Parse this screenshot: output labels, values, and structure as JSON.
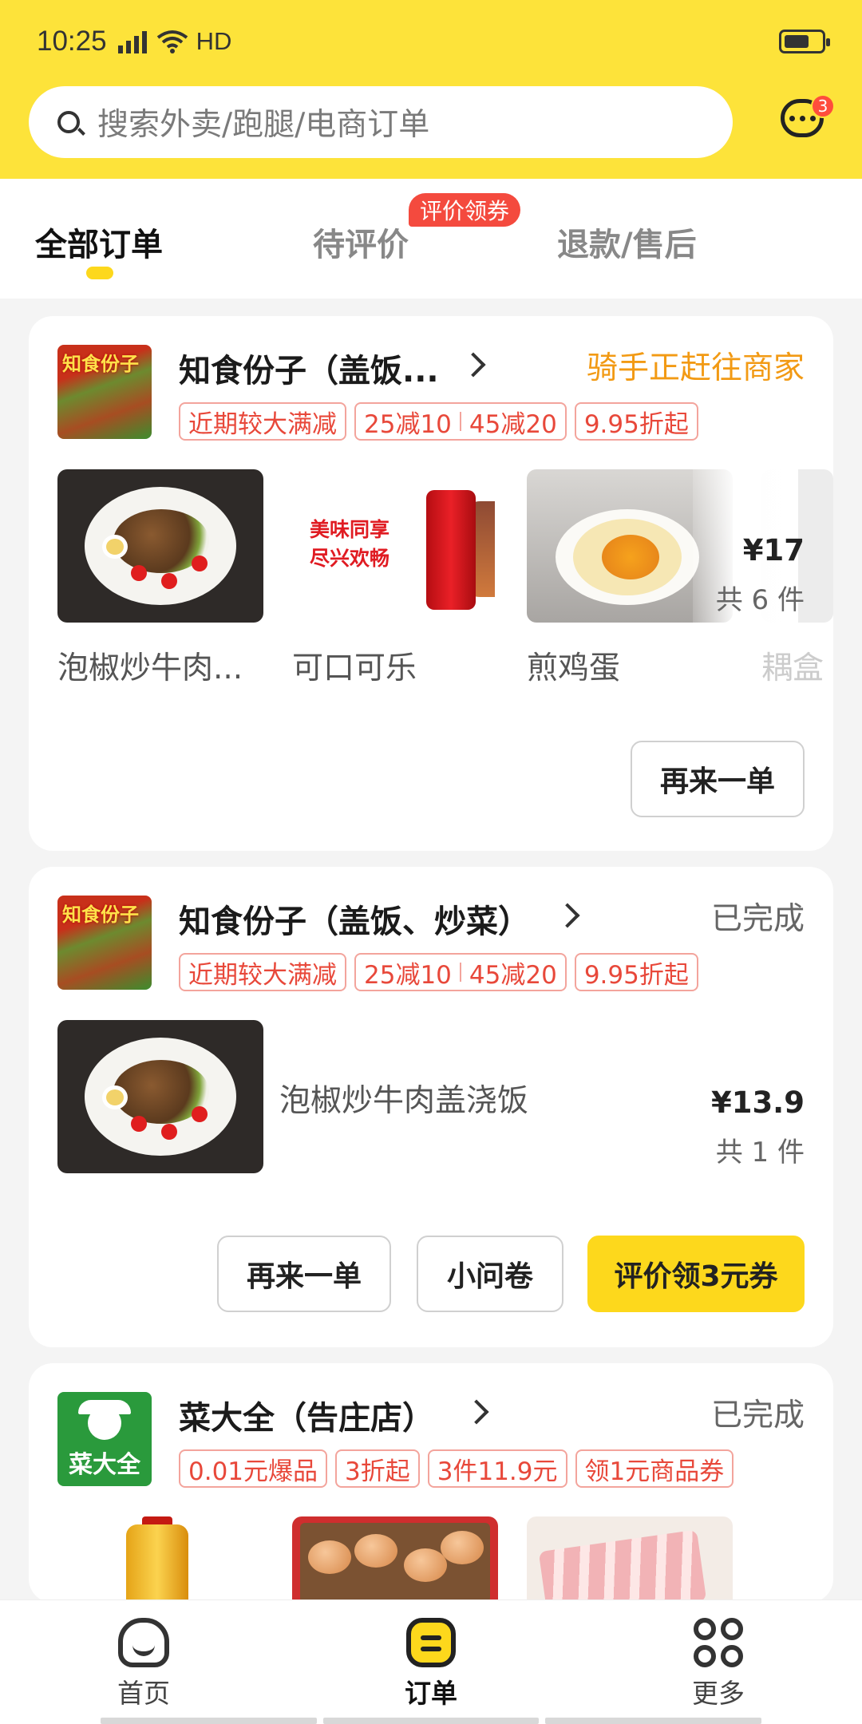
{
  "status_bar": {
    "time": "10:25",
    "network": "4G",
    "extra": "HD"
  },
  "search": {
    "placeholder": "搜索外卖/跑腿/电商订单"
  },
  "messages": {
    "badge": "3"
  },
  "tabs": [
    {
      "label": "全部订单",
      "active": true
    },
    {
      "label": "待评价",
      "active": false,
      "pill": "评价领券"
    },
    {
      "label": "退款/售后",
      "active": false
    }
  ],
  "orders": [
    {
      "shop": "知食份子（盖饭...",
      "logo_text": "知食份子",
      "status": "骑手正赶往商家",
      "tags": [
        "近期较大满减",
        "25减10",
        "45减20",
        "9.95折起"
      ],
      "items": [
        "泡椒炒牛肉...",
        "可口可乐",
        "煎鸡蛋",
        "耦盒"
      ],
      "cola_slogan": [
        "美味同享",
        "尽兴欢畅"
      ],
      "price": "¥17",
      "count": "共 6 件",
      "buttons": [
        "再来一单"
      ]
    },
    {
      "shop": "知食份子（盖饭、炒菜）",
      "logo_text": "知食份子",
      "status": "已完成",
      "tags": [
        "近期较大满减",
        "25减10",
        "45减20",
        "9.95折起"
      ],
      "item_name": "泡椒炒牛肉盖浇饭",
      "price": "¥13.9",
      "count": "共 1 件",
      "buttons": [
        "再来一单",
        "小问卷",
        "评价领3元券"
      ]
    },
    {
      "shop": "菜大全（告庄店）",
      "logo_text": "菜大全",
      "status": "已完成",
      "tags": [
        "0.01元爆品",
        "3折起",
        "3件11.9元",
        "领1元商品券"
      ]
    }
  ],
  "nav": [
    {
      "label": "首页",
      "icon": "home-icon"
    },
    {
      "label": "订单",
      "icon": "order-icon",
      "active": true
    },
    {
      "label": "更多",
      "icon": "grid-icon"
    }
  ],
  "colors": {
    "brand_yellow": "#fde33a",
    "status_orange": "#f29a14",
    "tag_red": "#e8483a"
  }
}
